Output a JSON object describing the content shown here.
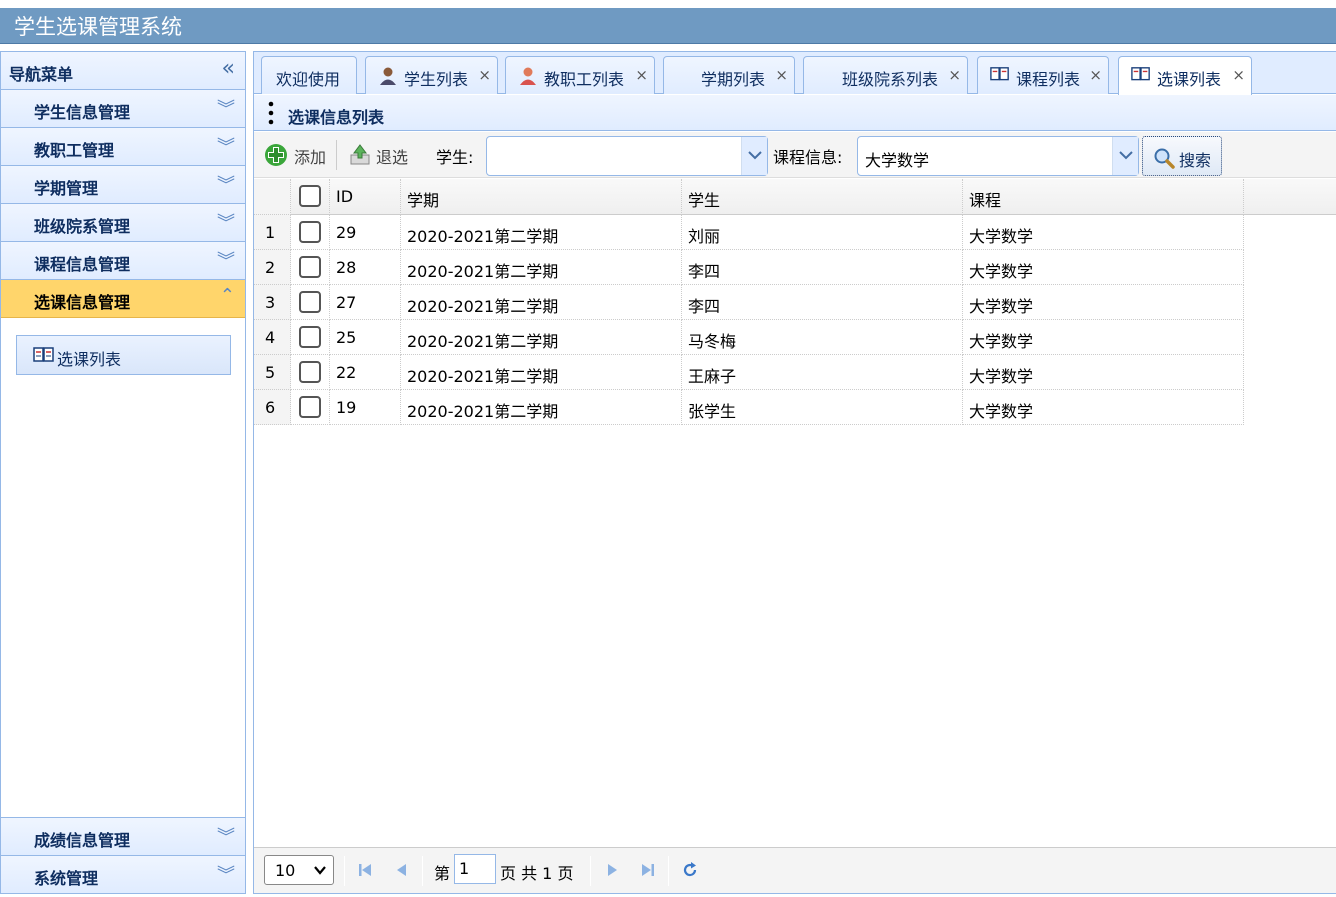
{
  "app": {
    "title": "学生选课管理系统"
  },
  "sidebar": {
    "header": "导航菜单",
    "collapse_icon": "double-chevron-left-icon",
    "items": [
      {
        "label": "学生信息管理",
        "expanded": false
      },
      {
        "label": "教职工管理",
        "expanded": false
      },
      {
        "label": "学期管理",
        "expanded": false
      },
      {
        "label": "班级院系管理",
        "expanded": false
      },
      {
        "label": "课程信息管理",
        "expanded": false
      },
      {
        "label": "选课信息管理",
        "expanded": true
      }
    ],
    "sub_items": [
      {
        "label": "选课列表",
        "icon": "book-icon"
      }
    ],
    "bottom_items": [
      {
        "label": "成绩信息管理"
      },
      {
        "label": "系统管理"
      }
    ]
  },
  "tabs": [
    {
      "label": "欢迎使用",
      "icon": "",
      "closable": false
    },
    {
      "label": "学生列表",
      "icon": "student-icon",
      "closable": true
    },
    {
      "label": "教职工列表",
      "icon": "teacher-icon",
      "closable": true
    },
    {
      "label": "学期列表",
      "icon": "",
      "closable": true
    },
    {
      "label": "班级院系列表",
      "icon": "",
      "closable": true
    },
    {
      "label": "课程列表",
      "icon": "book-icon",
      "closable": true
    },
    {
      "label": "选课列表",
      "icon": "book-icon",
      "closable": true,
      "selected": true
    }
  ],
  "close_glyph": "×",
  "panel": {
    "title": "选课信息列表"
  },
  "toolbar": {
    "add_label": "添加",
    "withdraw_label": "退选",
    "student_label": "学生:",
    "student_value": "",
    "course_label": "课程信息:",
    "course_value": "大学数学",
    "search_label": "搜索"
  },
  "grid": {
    "columns": [
      "ID",
      "学期",
      "学生",
      "课程"
    ],
    "rows": [
      {
        "num": "1",
        "id": "29",
        "term": "2020-2021第二学期",
        "student": "刘丽",
        "course": "大学数学"
      },
      {
        "num": "2",
        "id": "28",
        "term": "2020-2021第二学期",
        "student": "李四",
        "course": "大学数学"
      },
      {
        "num": "3",
        "id": "27",
        "term": "2020-2021第二学期",
        "student": "李四",
        "course": "大学数学"
      },
      {
        "num": "4",
        "id": "25",
        "term": "2020-2021第二学期",
        "student": "马冬梅",
        "course": "大学数学"
      },
      {
        "num": "5",
        "id": "22",
        "term": "2020-2021第二学期",
        "student": "王麻子",
        "course": "大学数学"
      },
      {
        "num": "6",
        "id": "19",
        "term": "2020-2021第二学期",
        "student": "张学生",
        "course": "大学数学"
      }
    ]
  },
  "pager": {
    "page_size": "10",
    "page_prefix": "第",
    "current_page": "1",
    "page_suffix": "页 共 1 页"
  },
  "colors": {
    "accent": "#6f9ac2",
    "active_menu": "#ffd56b",
    "border": "#95b8e7"
  }
}
